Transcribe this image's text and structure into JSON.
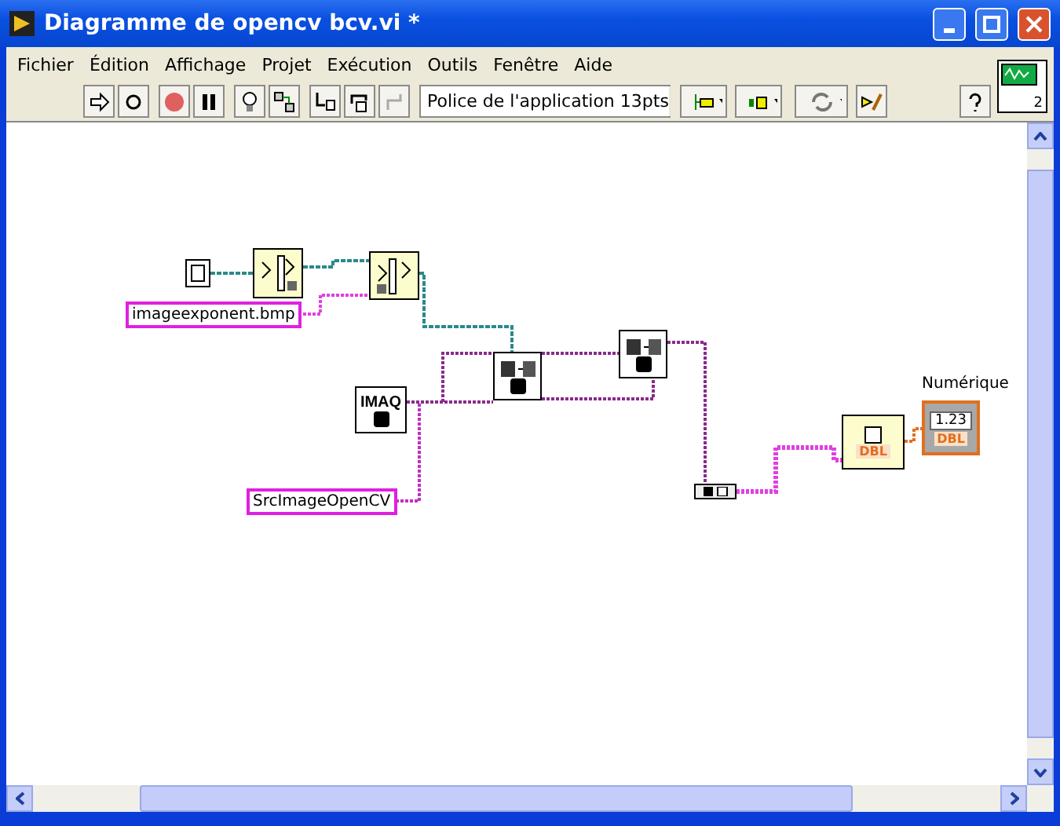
{
  "window": {
    "title": "Diagramme de opencv bcv.vi *"
  },
  "menu": [
    "Fichier",
    "Édition",
    "Affichage",
    "Projet",
    "Exécution",
    "Outils",
    "Fenêtre",
    "Aide"
  ],
  "toolbar": {
    "font": "Police de l'application 13pts",
    "connector_count": "2"
  },
  "diagram": {
    "string_constants": [
      {
        "text": "imageexponent.bmp"
      },
      {
        "text": "SrcImageOpenCV"
      }
    ],
    "imaq_label": "IMAQ",
    "converter_output": "DBL",
    "indicator": {
      "label": "Numérique",
      "value": "1.23",
      "type": "DBL"
    }
  }
}
